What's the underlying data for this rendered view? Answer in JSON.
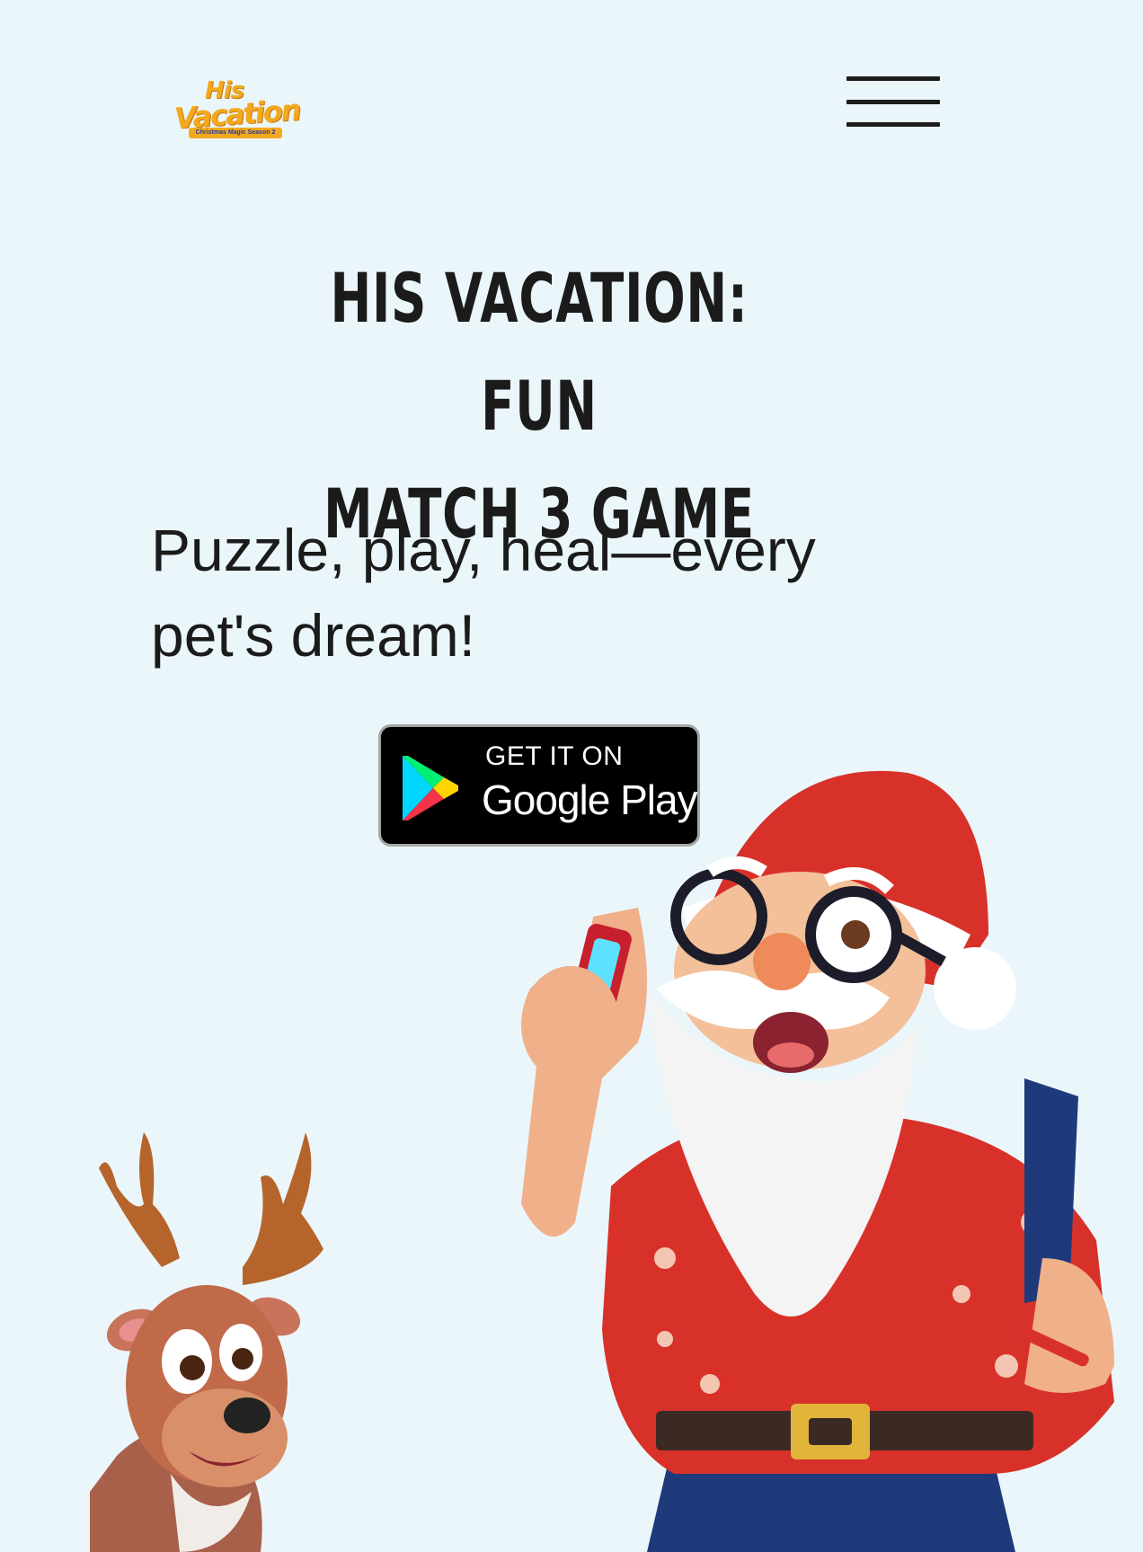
{
  "header": {
    "logo": {
      "line1": "His",
      "line2": "Vacation",
      "tagline": "Christmas Magic Season 2"
    },
    "menu_icon": "hamburger-menu-icon"
  },
  "hero": {
    "title_line1": "His Vacation: Fun",
    "title_line2": "Match 3 Game",
    "subtitle_line1": "Puzzle, play, heal—every",
    "subtitle_line2": "pet's dream!"
  },
  "store_badge": {
    "small_text": "GET IT ON",
    "large_text": "Google Play",
    "icon": "google-play-icon"
  },
  "colors": {
    "background": "#eaf6fa",
    "text": "#1b1b1b",
    "logo": "#f2a91d",
    "badge_bg": "#000000"
  }
}
